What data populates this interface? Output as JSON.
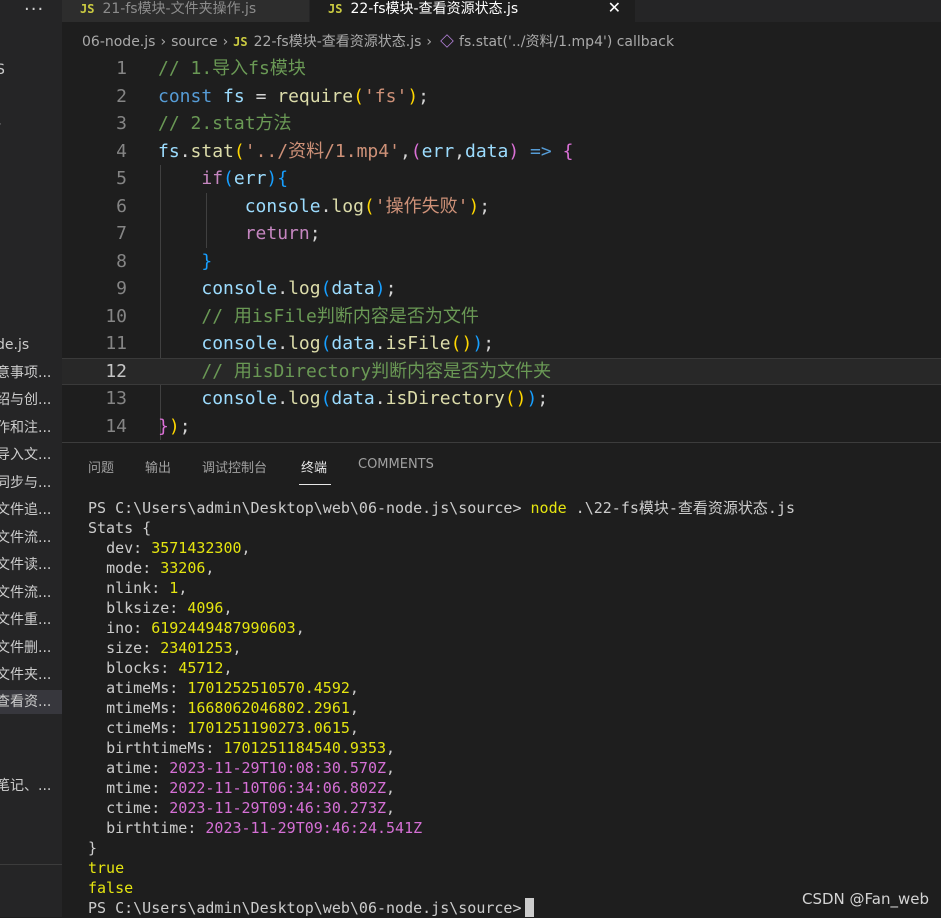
{
  "sidebar": {
    "more_label": "...",
    "items": [
      "S",
      "-",
      "de.js",
      "意事项...",
      "绍与创...",
      "作和注...",
      "导入文...",
      "同步与...",
      "文件追...",
      "文件流...",
      "文件读...",
      "文件流...",
      "文件重...",
      "文件删...",
      "文件夹...",
      "查看资...",
      "笔记、..."
    ],
    "active_index": 15
  },
  "tabs": [
    {
      "badge": "JS",
      "label": "21-fs模块-文件夹操作.js",
      "active": false
    },
    {
      "badge": "JS",
      "label": "22-fs模块-查看资源状态.js",
      "active": true,
      "close": "✕"
    }
  ],
  "breadcrumb": {
    "parts": [
      "06-node.js",
      "source"
    ],
    "file_badge": "JS",
    "file": "22-fs模块-查看资源状态.js",
    "symbol": "fs.stat('../资料/1.mp4') callback",
    "separator": "›"
  },
  "editor": {
    "line_numbers": [
      "1",
      "2",
      "3",
      "4",
      "5",
      "6",
      "7",
      "8",
      "9",
      "10",
      "11",
      "12",
      "13",
      "14"
    ],
    "current_line": 12,
    "code": {
      "l1": {
        "comment": "// 1.导入fs模块"
      },
      "l2": {
        "k": "const",
        "v": "fs",
        "eq": "=",
        "fn": "require",
        "o": "(",
        "s": "'fs'",
        "c": ")",
        "semi": ";"
      },
      "l3": {
        "comment": "// 2.stat方法"
      },
      "l4": {
        "v": "fs",
        "dot": ".",
        "fn": "stat",
        "o": "(",
        "s": "'../资料/1.mp4'",
        "comma": ",",
        "o2": "(",
        "a1": "err",
        "comma2": ",",
        "a2": "data",
        "c2": ")",
        "arrow": "=>",
        "brace": "{"
      },
      "l5": {
        "k": "if",
        "o": "(",
        "v": "err",
        "c": ")",
        "brace": "{"
      },
      "l6": {
        "v": "console",
        "dot": ".",
        "fn": "log",
        "o": "(",
        "s": "'操作失败'",
        "c": ")",
        "semi": ";"
      },
      "l7": {
        "k": "return",
        "semi": ";"
      },
      "l8": {
        "brace": "}"
      },
      "l9": {
        "v": "console",
        "dot": ".",
        "fn": "log",
        "o": "(",
        "v2": "data",
        "c": ")",
        "semi": ";"
      },
      "l10": {
        "comment": "// 用isFile判断内容是否为文件"
      },
      "l11": {
        "v": "console",
        "dot": ".",
        "fn": "log",
        "o": "(",
        "v2": "data",
        "dot2": ".",
        "fn2": "isFile",
        "o2": "()",
        "c": ")",
        "semi": ";"
      },
      "l12": {
        "comment": "// 用isDirectory判断内容是否为文件夹"
      },
      "l13": {
        "v": "console",
        "dot": ".",
        "fn": "log",
        "o": "(",
        "v2": "data",
        "dot2": ".",
        "fn2": "isDirectory",
        "o2": "()",
        "c": ")",
        "semi": ";"
      },
      "l14": {
        "brace": "}",
        "c": ")",
        "semi": ";"
      }
    }
  },
  "panel": {
    "tabs": [
      "问题",
      "输出",
      "调试控制台",
      "终端",
      "COMMENTS"
    ],
    "active_tab": "终端"
  },
  "terminal": {
    "prompt": "PS C:\\Users\\admin\\Desktop\\web\\06-node.js\\source>",
    "command": "node",
    "command_arg": ".\\22-fs模块-查看资源状态.js",
    "stats_open": "Stats {",
    "fields": [
      {
        "key": "dev",
        "value": "3571432300",
        "kind": "num"
      },
      {
        "key": "mode",
        "value": "33206",
        "kind": "num"
      },
      {
        "key": "nlink",
        "value": "1",
        "kind": "num"
      },
      {
        "key": "blksize",
        "value": "4096",
        "kind": "num"
      },
      {
        "key": "ino",
        "value": "6192449487990603",
        "kind": "num"
      },
      {
        "key": "size",
        "value": "23401253",
        "kind": "num"
      },
      {
        "key": "blocks",
        "value": "45712",
        "kind": "num"
      },
      {
        "key": "atimeMs",
        "value": "1701252510570.4592",
        "kind": "num"
      },
      {
        "key": "mtimeMs",
        "value": "1668062046802.2961",
        "kind": "num"
      },
      {
        "key": "ctimeMs",
        "value": "1701251190273.0615",
        "kind": "num"
      },
      {
        "key": "birthtimeMs",
        "value": "1701251184540.9353",
        "kind": "num"
      },
      {
        "key": "atime",
        "value": "2023-11-29T10:08:30.570Z",
        "kind": "date"
      },
      {
        "key": "mtime",
        "value": "2022-11-10T06:34:06.802Z",
        "kind": "date"
      },
      {
        "key": "ctime",
        "value": "2023-11-29T09:46:30.273Z",
        "kind": "date"
      },
      {
        "key": "birthtime",
        "value": "2023-11-29T09:46:24.541Z",
        "kind": "date"
      }
    ],
    "stats_close": "}",
    "result_is_file": "true",
    "result_is_dir": "false",
    "final_prompt": "PS C:\\Users\\admin\\Desktop\\web\\06-node.js\\source>"
  },
  "watermark": "CSDN @Fan_web",
  "colors": {
    "background": "#1e1e1e",
    "sidebar": "#252526",
    "number": "#e5e510",
    "date": "#d670d6",
    "comment": "#6a9955"
  }
}
